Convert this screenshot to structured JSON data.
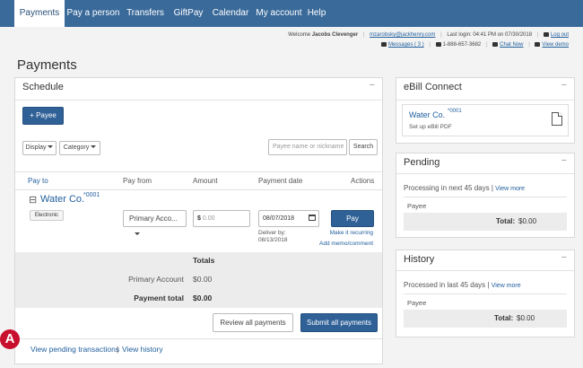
{
  "nav": {
    "items": [
      "Payments",
      "Pay a person",
      "Transfers",
      "GiftPay",
      "Calendar",
      "My account",
      "Help"
    ]
  },
  "util": {
    "welcome_prefix": "Welcome",
    "user_name": "Jacobs Clevenger",
    "email": "mzarobsky@jackhenry.com",
    "last_login": "Last login: 04:41 PM on 07/30/2018",
    "logout": "Log out",
    "messages": "Messages ( 3 )",
    "phone": "1-888-657-3682",
    "chat": "Chat Now",
    "demo": "View demo"
  },
  "page_title": "Payments",
  "schedule": {
    "title": "Schedule",
    "add_payee": "+ Payee",
    "display": "Display",
    "category": "Category",
    "search_placeholder": "Payee name or nickname",
    "search_button": "Search",
    "headers": {
      "pay_to": "Pay to",
      "pay_from": "Pay from",
      "amount": "Amount",
      "payment_date": "Payment date",
      "actions": "Actions"
    },
    "payee": {
      "expand": "⊟",
      "name": "Water Co.",
      "account": "*0001",
      "tag": "Electronic",
      "pay_from": "Primary Acco...",
      "amount_symbol": "$",
      "amount_placeholder": "0.00",
      "date": "08/07/2018",
      "deliver_label": "Deliver by:",
      "deliver_date": "08/13/2018",
      "pay_button": "Pay",
      "recurring": "Make it recurring",
      "memo": "Add memo/comment"
    },
    "totals": {
      "title": "Totals",
      "primary_label": "Primary Account",
      "primary_value": "$0.00",
      "total_label": "Payment total",
      "total_value": "$0.00"
    },
    "review": "Review all payments",
    "submit": "Submit all payments",
    "pending_link": "View pending transactions",
    "divider": "|",
    "history_link": "View history"
  },
  "ebill": {
    "title": "eBill Connect",
    "payee": "Water Co.",
    "account": "*0001",
    "setup": "Set up eBill PDF"
  },
  "pending": {
    "title": "Pending",
    "subtitle": "Processing in next 45 days",
    "view_more": "View more",
    "column": "Payee",
    "total_label": "Total:",
    "total_value": "$0.00"
  },
  "history": {
    "title": "History",
    "subtitle": "Processed in last 45 days",
    "view_more": "View more",
    "column": "Payee",
    "total_label": "Total:",
    "total_value": "$0.00"
  },
  "callout": "A",
  "minimize": "−",
  "colors": {
    "nav": "#3a6a9a",
    "primary": "#2f6197",
    "callout": "#c8102e"
  },
  "icons": [
    "add-icon",
    "caret-down-icon",
    "calendar-icon",
    "pdf-icon",
    "envelope-icon",
    "phone-icon",
    "chat-icon",
    "logout-icon",
    "demo-icon"
  ]
}
